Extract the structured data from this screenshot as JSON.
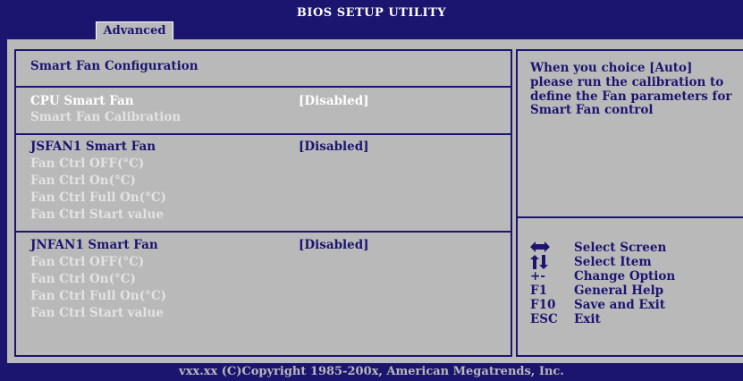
{
  "header": {
    "title": "BIOS SETUP UTILITY",
    "tab_active": "Advanced"
  },
  "section_title": "Smart Fan Configuration",
  "groups": [
    {
      "items": [
        {
          "label": "CPU Smart Fan",
          "value": "[Disabled]"
        },
        {
          "label": "Smart Fan Calibration",
          "value": ""
        }
      ]
    },
    {
      "items": [
        {
          "label": "JSFAN1 Smart Fan",
          "value": "[Disabled]"
        },
        {
          "label": "Fan Ctrl OFF(°C)",
          "value": ""
        },
        {
          "label": "Fan Ctrl On(°C)",
          "value": ""
        },
        {
          "label": "Fan Ctrl Full On(°C)",
          "value": ""
        },
        {
          "label": "Fan Ctrl Start value",
          "value": ""
        }
      ]
    },
    {
      "items": [
        {
          "label": "JNFAN1 Smart Fan",
          "value": "[Disabled]"
        },
        {
          "label": "Fan Ctrl OFF(°C)",
          "value": ""
        },
        {
          "label": "Fan Ctrl On(°C)",
          "value": ""
        },
        {
          "label": "Fan Ctrl Full On(°C)",
          "value": ""
        },
        {
          "label": "Fan Ctrl Start value",
          "value": ""
        }
      ]
    }
  ],
  "help": {
    "text": "When you choice [Auto] please run the calibration to define the Fan parameters for Smart Fan control"
  },
  "keys": [
    {
      "icon": "left-right-arrows-icon",
      "symbol": "",
      "desc": "Select Screen"
    },
    {
      "icon": "up-down-arrows-icon",
      "symbol": "",
      "desc": "Select Item"
    },
    {
      "icon": "",
      "symbol": "+-",
      "desc": "Change Option"
    },
    {
      "icon": "",
      "symbol": "F1",
      "desc": "General Help"
    },
    {
      "icon": "",
      "symbol": "F10",
      "desc": "Save and Exit"
    },
    {
      "icon": "",
      "symbol": "ESC",
      "desc": "Exit"
    }
  ],
  "footer": "vxx.xx (C)Copyright 1985-200x, American Megatrends, Inc.",
  "colors": {
    "background": "#1b1570",
    "panel": "#b9b9b9",
    "highlight_text": "#ffffff",
    "disabled_text": "#e3e3e3"
  }
}
